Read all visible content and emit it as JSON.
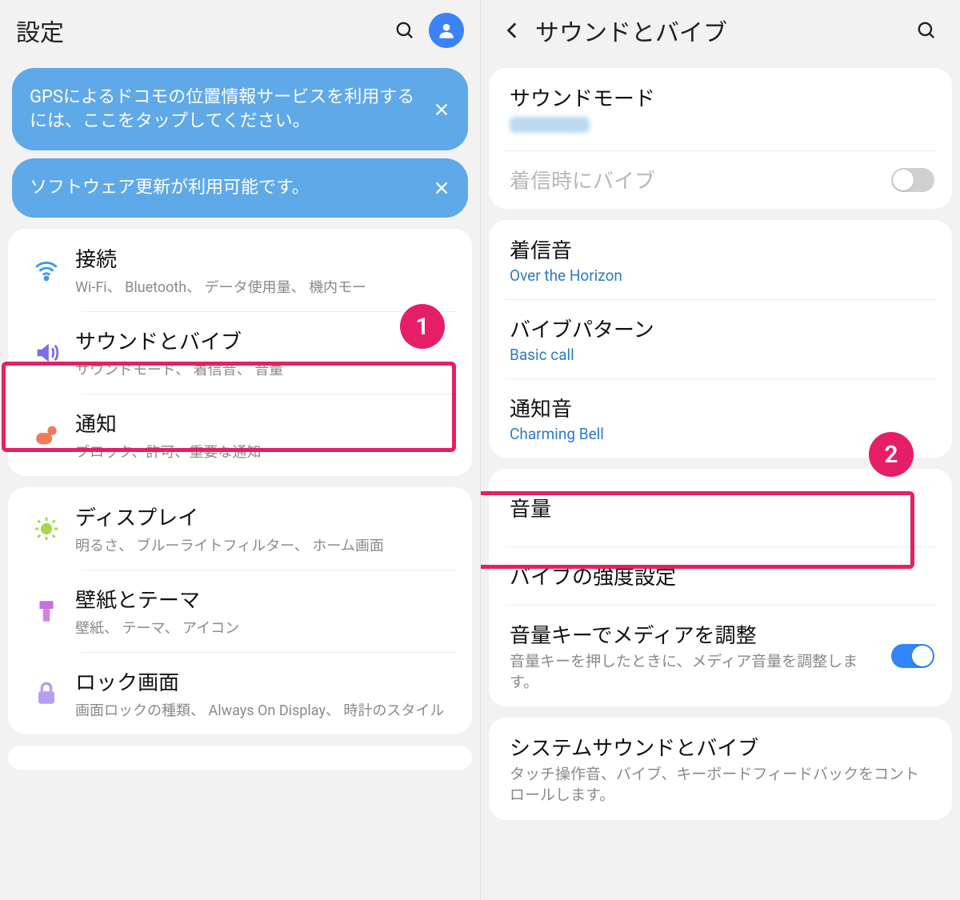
{
  "left": {
    "header": {
      "title": "設定"
    },
    "banners": [
      {
        "text": "GPSによるドコモの位置情報サービスを利用するには、ここをタップしてください。"
      },
      {
        "text": "ソフトウェア更新が利用可能です。"
      }
    ],
    "groups": [
      {
        "items": [
          {
            "icon": "wifi",
            "color": "#3b9ae8",
            "title": "接続",
            "sub": "Wi-Fi、 Bluetooth、 データ使用量、 機内モー"
          },
          {
            "icon": "sound",
            "color": "#7a6fe6",
            "title": "サウンドとバイブ",
            "sub": "サウンドモード、 着信音、 音量",
            "highlight": true
          },
          {
            "icon": "notif",
            "color": "#f07a5c",
            "title": "通知",
            "sub": "ブロック、許可、重要な通知"
          }
        ]
      },
      {
        "items": [
          {
            "icon": "display",
            "color": "#8bd24a",
            "title": "ディスプレイ",
            "sub": "明るさ、 ブルーライトフィルター、 ホーム画面"
          },
          {
            "icon": "theme",
            "color": "#c86fe0",
            "title": "壁紙とテーマ",
            "sub": "壁紙、 テーマ、 アイコン"
          },
          {
            "icon": "lock",
            "color": "#b79df0",
            "title": "ロック画面",
            "sub": "画面ロックの種類、 Always On Display、 時計のスタイル"
          }
        ]
      }
    ],
    "badge": "1"
  },
  "right": {
    "header": {
      "title": "サウンドとバイブ"
    },
    "section1": {
      "mode_label": "サウンドモード",
      "vibrate_label": "着信時にバイブ"
    },
    "section2": {
      "ringtone_label": "着信音",
      "ringtone_value": "Over the Horizon",
      "vibpattern_label": "バイブパターン",
      "vibpattern_value": "Basic call",
      "notif_label": "通知音",
      "notif_value": "Charming Bell"
    },
    "section3": {
      "volume_label": "音量",
      "intensity_label": "バイブの強度設定",
      "mediakey_label": "音量キーでメディアを調整",
      "mediakey_sub": "音量キーを押したときに、メディア音量を調整します。"
    },
    "section4": {
      "system_label": "システムサウンドとバイブ",
      "system_sub": "タッチ操作音、バイブ、キーボードフィードバックをコントロールします。"
    },
    "badge": "2"
  }
}
